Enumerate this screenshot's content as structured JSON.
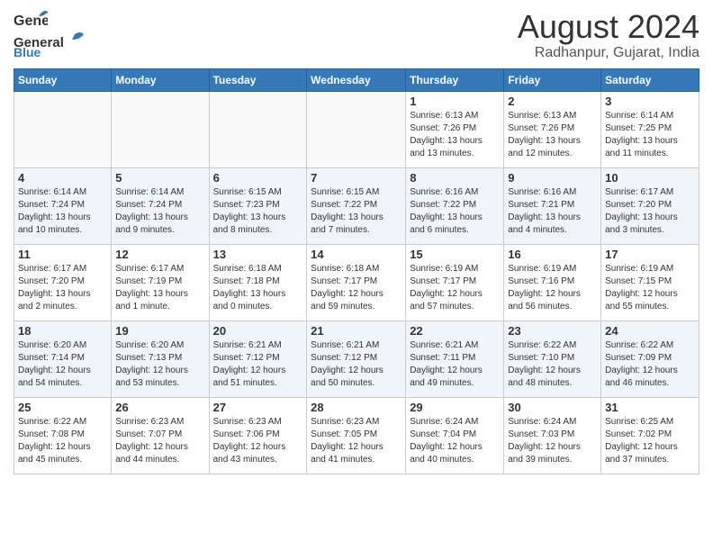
{
  "header": {
    "logo_general": "General",
    "logo_blue": "Blue",
    "month_title": "August 2024",
    "location": "Radhanpur, Gujarat, India"
  },
  "weekdays": [
    "Sunday",
    "Monday",
    "Tuesday",
    "Wednesday",
    "Thursday",
    "Friday",
    "Saturday"
  ],
  "weeks": [
    [
      {
        "day": "",
        "info": ""
      },
      {
        "day": "",
        "info": ""
      },
      {
        "day": "",
        "info": ""
      },
      {
        "day": "",
        "info": ""
      },
      {
        "day": "1",
        "info": "Sunrise: 6:13 AM\nSunset: 7:26 PM\nDaylight: 13 hours\nand 13 minutes."
      },
      {
        "day": "2",
        "info": "Sunrise: 6:13 AM\nSunset: 7:26 PM\nDaylight: 13 hours\nand 12 minutes."
      },
      {
        "day": "3",
        "info": "Sunrise: 6:14 AM\nSunset: 7:25 PM\nDaylight: 13 hours\nand 11 minutes."
      }
    ],
    [
      {
        "day": "4",
        "info": "Sunrise: 6:14 AM\nSunset: 7:24 PM\nDaylight: 13 hours\nand 10 minutes."
      },
      {
        "day": "5",
        "info": "Sunrise: 6:14 AM\nSunset: 7:24 PM\nDaylight: 13 hours\nand 9 minutes."
      },
      {
        "day": "6",
        "info": "Sunrise: 6:15 AM\nSunset: 7:23 PM\nDaylight: 13 hours\nand 8 minutes."
      },
      {
        "day": "7",
        "info": "Sunrise: 6:15 AM\nSunset: 7:22 PM\nDaylight: 13 hours\nand 7 minutes."
      },
      {
        "day": "8",
        "info": "Sunrise: 6:16 AM\nSunset: 7:22 PM\nDaylight: 13 hours\nand 6 minutes."
      },
      {
        "day": "9",
        "info": "Sunrise: 6:16 AM\nSunset: 7:21 PM\nDaylight: 13 hours\nand 4 minutes."
      },
      {
        "day": "10",
        "info": "Sunrise: 6:17 AM\nSunset: 7:20 PM\nDaylight: 13 hours\nand 3 minutes."
      }
    ],
    [
      {
        "day": "11",
        "info": "Sunrise: 6:17 AM\nSunset: 7:20 PM\nDaylight: 13 hours\nand 2 minutes."
      },
      {
        "day": "12",
        "info": "Sunrise: 6:17 AM\nSunset: 7:19 PM\nDaylight: 13 hours\nand 1 minute."
      },
      {
        "day": "13",
        "info": "Sunrise: 6:18 AM\nSunset: 7:18 PM\nDaylight: 13 hours\nand 0 minutes."
      },
      {
        "day": "14",
        "info": "Sunrise: 6:18 AM\nSunset: 7:17 PM\nDaylight: 12 hours\nand 59 minutes."
      },
      {
        "day": "15",
        "info": "Sunrise: 6:19 AM\nSunset: 7:17 PM\nDaylight: 12 hours\nand 57 minutes."
      },
      {
        "day": "16",
        "info": "Sunrise: 6:19 AM\nSunset: 7:16 PM\nDaylight: 12 hours\nand 56 minutes."
      },
      {
        "day": "17",
        "info": "Sunrise: 6:19 AM\nSunset: 7:15 PM\nDaylight: 12 hours\nand 55 minutes."
      }
    ],
    [
      {
        "day": "18",
        "info": "Sunrise: 6:20 AM\nSunset: 7:14 PM\nDaylight: 12 hours\nand 54 minutes."
      },
      {
        "day": "19",
        "info": "Sunrise: 6:20 AM\nSunset: 7:13 PM\nDaylight: 12 hours\nand 53 minutes."
      },
      {
        "day": "20",
        "info": "Sunrise: 6:21 AM\nSunset: 7:12 PM\nDaylight: 12 hours\nand 51 minutes."
      },
      {
        "day": "21",
        "info": "Sunrise: 6:21 AM\nSunset: 7:12 PM\nDaylight: 12 hours\nand 50 minutes."
      },
      {
        "day": "22",
        "info": "Sunrise: 6:21 AM\nSunset: 7:11 PM\nDaylight: 12 hours\nand 49 minutes."
      },
      {
        "day": "23",
        "info": "Sunrise: 6:22 AM\nSunset: 7:10 PM\nDaylight: 12 hours\nand 48 minutes."
      },
      {
        "day": "24",
        "info": "Sunrise: 6:22 AM\nSunset: 7:09 PM\nDaylight: 12 hours\nand 46 minutes."
      }
    ],
    [
      {
        "day": "25",
        "info": "Sunrise: 6:22 AM\nSunset: 7:08 PM\nDaylight: 12 hours\nand 45 minutes."
      },
      {
        "day": "26",
        "info": "Sunrise: 6:23 AM\nSunset: 7:07 PM\nDaylight: 12 hours\nand 44 minutes."
      },
      {
        "day": "27",
        "info": "Sunrise: 6:23 AM\nSunset: 7:06 PM\nDaylight: 12 hours\nand 43 minutes."
      },
      {
        "day": "28",
        "info": "Sunrise: 6:23 AM\nSunset: 7:05 PM\nDaylight: 12 hours\nand 41 minutes."
      },
      {
        "day": "29",
        "info": "Sunrise: 6:24 AM\nSunset: 7:04 PM\nDaylight: 12 hours\nand 40 minutes."
      },
      {
        "day": "30",
        "info": "Sunrise: 6:24 AM\nSunset: 7:03 PM\nDaylight: 12 hours\nand 39 minutes."
      },
      {
        "day": "31",
        "info": "Sunrise: 6:25 AM\nSunset: 7:02 PM\nDaylight: 12 hours\nand 37 minutes."
      }
    ]
  ]
}
